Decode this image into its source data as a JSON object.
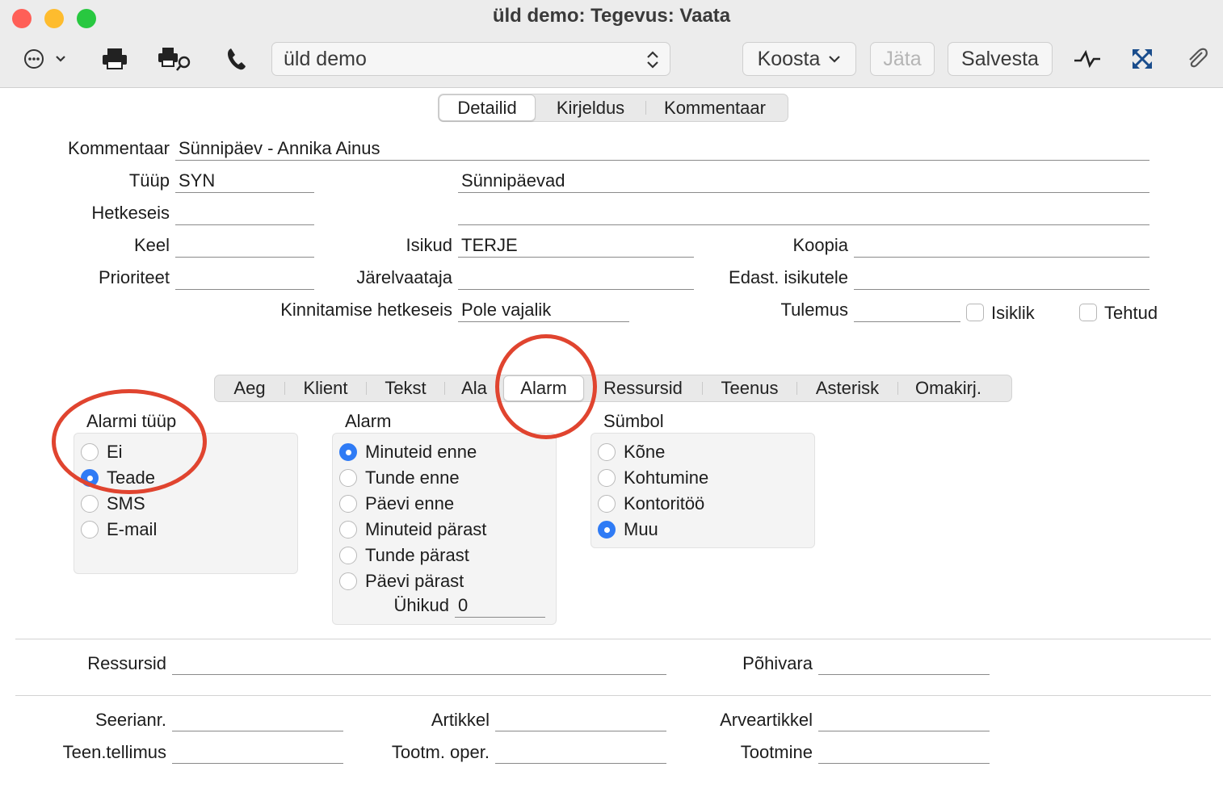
{
  "window": {
    "title": "üld demo: Tegevus: Vaata"
  },
  "toolbar": {
    "project": "üld demo",
    "koosta_label": "Koosta",
    "jata_label": "Jäta",
    "salvesta_label": "Salvesta"
  },
  "top_tabs": [
    "Detailid",
    "Kirjeldus",
    "Kommentaar"
  ],
  "form": {
    "kommentaar_label": "Kommentaar",
    "kommentaar_value": "Sünnipäev - Annika Ainus",
    "tyyp_label": "Tüüp",
    "tyyp_value": "SYN",
    "tyyp_desc": "Sünnipäevad",
    "hetkeseis_label": "Hetkeseis",
    "keel_label": "Keel",
    "isikud_label": "Isikud",
    "isikud_value": "TERJE",
    "koopia_label": "Koopia",
    "prioriteet_label": "Prioriteet",
    "jarelvaataja_label": "Järelvaataja",
    "edast_label": "Edast. isikutele",
    "kinnitamise_label": "Kinnitamise hetkeseis",
    "kinnitamise_value": "Pole vajalik",
    "tulemus_label": "Tulemus",
    "isiklik_label": "Isiklik",
    "tehtud_label": "Tehtud"
  },
  "sub_tabs": [
    "Aeg",
    "Klient",
    "Tekst",
    "Ala",
    "Alarm",
    "Ressursid",
    "Teenus",
    "Asterisk",
    "Omakirj."
  ],
  "alarmi_tyyp": {
    "title": "Alarmi tüüp",
    "options": [
      "Ei",
      "Teade",
      "SMS",
      "E-mail"
    ],
    "selected": "Teade"
  },
  "alarm": {
    "title": "Alarm",
    "options": [
      "Minuteid enne",
      "Tunde enne",
      "Päevi enne",
      "Minuteid pärast",
      "Tunde pärast",
      "Päevi pärast"
    ],
    "selected": "Minuteid enne",
    "uhikud_label": "Ühikud",
    "uhikud_value": "0"
  },
  "symbol": {
    "title": "Sümbol",
    "options": [
      "Kõne",
      "Kohtumine",
      "Kontoritöö",
      "Muu"
    ],
    "selected": "Muu"
  },
  "bottom": {
    "ressursid_label": "Ressursid",
    "pohivara_label": "Põhivara",
    "seerianr_label": "Seerianr.",
    "artikkel_label": "Artikkel",
    "arveartikkel_label": "Arveartikkel",
    "teen_tellimus_label": "Teen.tellimus",
    "tootm_oper_label": "Tootm. oper.",
    "tootmine_label": "Tootmine"
  },
  "colors": {
    "accent": "#2f7bf5",
    "annotation": "#e0442f",
    "close": "#ff5f57",
    "minimize": "#febc2e",
    "zoom": "#28c840"
  }
}
